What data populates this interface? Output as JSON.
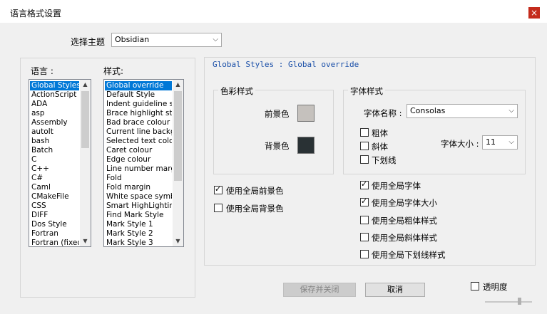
{
  "window": {
    "title": "语言格式设置",
    "close_glyph": "×"
  },
  "theme": {
    "label": "选择主题",
    "value": "Obsidian"
  },
  "languages": {
    "label": "语言 :",
    "items": [
      "Global Styles",
      "ActionScript",
      "ADA",
      "asp",
      "Assembly",
      "autoIt",
      "bash",
      "Batch",
      "C",
      "C++",
      "C#",
      "Caml",
      "CMakeFile",
      "CSS",
      "DIFF",
      "Dos Style",
      "Fortran",
      "Fortran (fixed"
    ],
    "selected": 0
  },
  "styles": {
    "label": "样式:",
    "items": [
      "Global override",
      "Default Style",
      "Indent guideline sty",
      "Brace highlight styl",
      "Bad brace colour",
      "Current line backgr",
      "Selected text colou",
      "Caret colour",
      "Edge colour",
      "Line number margin",
      "Fold",
      "Fold margin",
      "White space symbo",
      "Smart HighLighting",
      "Find Mark Style",
      "Mark Style 1",
      "Mark Style 2",
      "Mark Style 3"
    ],
    "selected": 0
  },
  "header": "Global Styles : Global override",
  "colour": {
    "group_label": "色彩样式",
    "fg_label": "前景色",
    "fg_color": "#c5c1bd",
    "bg_label": "背景色",
    "bg_color": "#293134"
  },
  "font": {
    "group_label": "字体样式",
    "name_label": "字体名称 :",
    "name_value": "Consolas",
    "bold": "粗体",
    "italic": "斜体",
    "underline": "下划线",
    "size_label": "字体大小 :",
    "size_value": "11"
  },
  "options": {
    "use_global_fg": "使用全局前景色",
    "use_global_bg": "使用全局背景色",
    "use_global_font": "使用全局字体",
    "use_global_size": "使用全局字体大小",
    "use_global_bold": "使用全局粗体样式",
    "use_global_italic": "使用全局斜体样式",
    "use_global_underline": "使用全局下划线样式"
  },
  "buttons": {
    "save": "保存并关闭",
    "cancel": "取消"
  },
  "transparency": {
    "label": "透明度"
  }
}
